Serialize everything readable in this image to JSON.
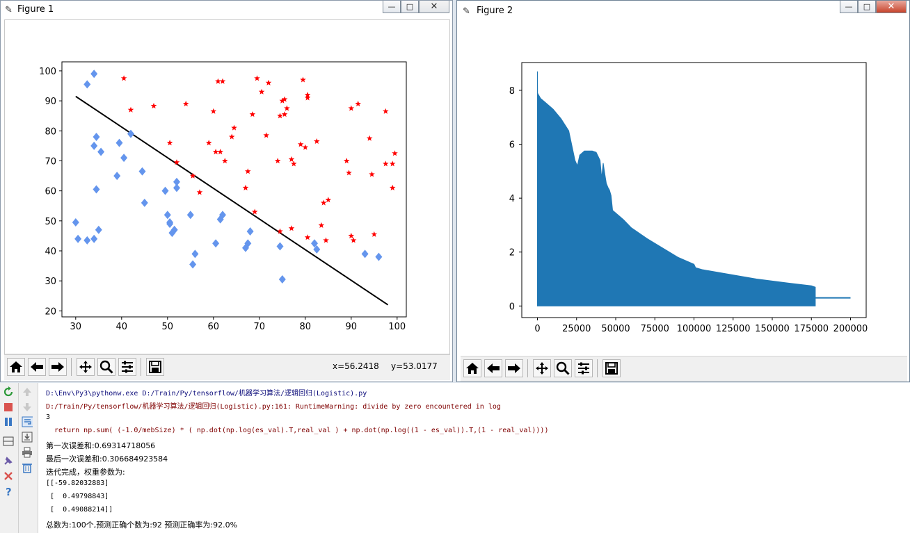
{
  "figure1": {
    "title": "Figure 1",
    "coord_x": "x=56.2418",
    "coord_y": "y=53.0177",
    "buttons": [
      "home",
      "back",
      "forward",
      "pan",
      "zoom",
      "configure",
      "save"
    ]
  },
  "figure2": {
    "title": "Figure 2",
    "buttons": [
      "home",
      "back",
      "forward",
      "pan",
      "zoom",
      "configure",
      "save"
    ]
  },
  "window_buttons": {
    "minimize": "—",
    "maximize": "□",
    "close": "✕"
  },
  "colors": {
    "positive": "#ff0000",
    "negative": "#6495ed",
    "line": "#000000",
    "cost": "#1f77b4",
    "error_text": "#7f0000",
    "path_text": "#0b0b7a"
  },
  "chart_data": [
    {
      "type": "scatter",
      "title": "",
      "xlabel": "",
      "ylabel": "",
      "xlim": [
        27,
        102
      ],
      "ylim": [
        18,
        103
      ],
      "xticks": [
        30,
        40,
        50,
        60,
        70,
        80,
        90,
        100
      ],
      "yticks": [
        20,
        30,
        40,
        50,
        60,
        70,
        80,
        90,
        100
      ],
      "series": [
        {
          "marker": "star",
          "color": "#ff0000",
          "points": [
            [
              40.5,
              97.5
            ],
            [
              42,
              87
            ],
            [
              47,
              88.3
            ],
            [
              50.5,
              76
            ],
            [
              52,
              69.5
            ],
            [
              54,
              89
            ],
            [
              55.5,
              65
            ],
            [
              57,
              59.5
            ],
            [
              60,
              86.5
            ],
            [
              60.5,
              73
            ],
            [
              61,
              96.5
            ],
            [
              61.5,
              73
            ],
            [
              62,
              96.5
            ],
            [
              62.5,
              70
            ],
            [
              59,
              76
            ],
            [
              64,
              78
            ],
            [
              64.5,
              81
            ],
            [
              67,
              61
            ],
            [
              67.5,
              66.5
            ],
            [
              68.5,
              85.5
            ],
            [
              69,
              53
            ],
            [
              69.5,
              97.5
            ],
            [
              70.5,
              93
            ],
            [
              71.5,
              78.5
            ],
            [
              72,
              96
            ],
            [
              74,
              70
            ],
            [
              74.5,
              85
            ],
            [
              75,
              90
            ],
            [
              75.5,
              85.5
            ],
            [
              76,
              87.5
            ],
            [
              75.5,
              90.5
            ],
            [
              77,
              70.5
            ],
            [
              77.5,
              69
            ],
            [
              79,
              75.5
            ],
            [
              79.5,
              97
            ],
            [
              80,
              74.5
            ],
            [
              80.5,
              92
            ],
            [
              80.5,
              91
            ],
            [
              82.5,
              76.5
            ],
            [
              83.5,
              48.5
            ],
            [
              84,
              56
            ],
            [
              85,
              57
            ],
            [
              74.5,
              46.5
            ],
            [
              77,
              47.5
            ],
            [
              80.5,
              44.5
            ],
            [
              84.5,
              43.5
            ],
            [
              89,
              70
            ],
            [
              89.5,
              66
            ],
            [
              90,
              87.5
            ],
            [
              90,
              45
            ],
            [
              90.5,
              43.5
            ],
            [
              91.5,
              89
            ],
            [
              94,
              77.5
            ],
            [
              94.5,
              65.5
            ],
            [
              95,
              45.5
            ],
            [
              97.5,
              69
            ],
            [
              97.5,
              86.5
            ],
            [
              99,
              69
            ],
            [
              99,
              61
            ],
            [
              99.5,
              72.5
            ]
          ]
        },
        {
          "marker": "diamond",
          "color": "#6495ed",
          "points": [
            [
              34,
              99
            ],
            [
              32.5,
              95.5
            ],
            [
              34.5,
              78
            ],
            [
              34,
              75
            ],
            [
              35.5,
              73
            ],
            [
              34.5,
              60.5
            ],
            [
              30,
              49.5
            ],
            [
              30.5,
              44
            ],
            [
              32.5,
              43.5
            ],
            [
              34,
              44
            ],
            [
              35,
              47
            ],
            [
              39,
              65
            ],
            [
              39.5,
              76
            ],
            [
              40.5,
              71
            ],
            [
              42,
              79
            ],
            [
              44.5,
              66.5
            ],
            [
              45,
              56
            ],
            [
              49.5,
              60
            ],
            [
              50,
              52
            ],
            [
              50.5,
              49.5
            ],
            [
              50.5,
              49
            ],
            [
              51,
              46
            ],
            [
              51.5,
              47
            ],
            [
              52,
              63
            ],
            [
              52,
              61
            ],
            [
              55,
              52
            ],
            [
              55.5,
              35.5
            ],
            [
              56,
              39
            ],
            [
              60.5,
              42.5
            ],
            [
              61.5,
              50.5
            ],
            [
              62,
              52
            ],
            [
              67,
              41
            ],
            [
              67.5,
              42.5
            ],
            [
              68,
              46.5
            ],
            [
              74.5,
              41.5
            ],
            [
              75,
              30.5
            ],
            [
              82,
              42.5
            ],
            [
              82.5,
              40.5
            ],
            [
              93,
              39
            ],
            [
              96,
              38
            ]
          ]
        }
      ],
      "decision_line": {
        "x": [
          30,
          98
        ],
        "y": [
          91.5,
          22
        ]
      }
    },
    {
      "type": "line",
      "title": "",
      "xlabel": "",
      "ylabel": "",
      "xlim": [
        -10000,
        210000
      ],
      "ylim": [
        -0.43,
        9.03
      ],
      "xticks": [
        0,
        25000,
        50000,
        75000,
        100000,
        125000,
        150000,
        175000,
        200000
      ],
      "yticks": [
        0,
        2,
        4,
        6,
        8
      ],
      "upper_envelope": {
        "x": [
          0,
          100,
          500,
          1000,
          2000,
          5000,
          10000,
          15000,
          20000,
          24000,
          25500,
          27000,
          30000,
          35000,
          37500,
          40000,
          41000,
          42000,
          43000,
          44000,
          45000,
          46000,
          47000,
          48000,
          50000,
          55000,
          60000,
          70000,
          80000,
          90000,
          100000,
          101000,
          105000,
          120000,
          140000,
          160000,
          175000,
          177500
        ],
        "y": [
          8.7,
          7.9,
          7.85,
          7.8,
          7.7,
          7.55,
          7.3,
          6.95,
          6.5,
          5.4,
          5.2,
          5.6,
          5.75,
          5.75,
          5.7,
          5.4,
          4.75,
          5.3,
          4.9,
          4.55,
          4.4,
          4.3,
          4.1,
          3.55,
          3.45,
          3.2,
          2.9,
          2.5,
          2.15,
          1.8,
          1.55,
          1.42,
          1.35,
          1.2,
          1.0,
          0.85,
          0.75,
          0.7
        ]
      },
      "lower_envelope": {
        "x": [
          0,
          177500
        ],
        "y": [
          0,
          0
        ]
      },
      "tail": {
        "x": [
          177500,
          200000
        ],
        "y": [
          0.3,
          0.3
        ]
      }
    }
  ],
  "console": {
    "lines": [
      {
        "text": "D:\\Env\\Py3\\pythonw.exe D:/Train/Py/tensorflow/机器学习算法/逻辑回归(Logistic).py",
        "kind": "path"
      },
      {
        "text": "D:/Train/Py/tensorflow/机器学习算法/逻辑回归(Logistic).py:161: RuntimeWarning: divide by zero encountered in log",
        "kind": "err"
      },
      {
        "text": "3",
        "kind": "out"
      },
      {
        "text": "  return np.sum( (-1.0/mebSize) * ( np.dot(np.log(es_val).T,real_val ) + np.dot(np.log((1 - es_val)).T,(1 - real_val))))",
        "kind": "err"
      },
      {
        "text": "第一次误差和:0.69314718056",
        "kind": "out"
      },
      {
        "text": "最后一次误差和:0.306684923584",
        "kind": "out"
      },
      {
        "text": "迭代完成，权重参数为:",
        "kind": "out"
      },
      {
        "text": "[[-59.82032883]",
        "kind": "out"
      },
      {
        "text": " [  0.49798843]",
        "kind": "out"
      },
      {
        "text": " [  0.49088214]]",
        "kind": "out"
      },
      {
        "text": "总数为:100个,预测正确个数为:92 预测正确率为:92.0%",
        "kind": "out"
      }
    ],
    "gutter_icons": [
      "rerun-icon",
      "stop-icon",
      "pause-icon",
      "layout-icon",
      "pin-icon",
      "close-icon",
      "help-icon"
    ],
    "gutter2_icons": [
      "up-arrow-icon",
      "down-arrow-icon",
      "soft-wrap-icon",
      "scroll-end-icon",
      "print-icon",
      "trash-icon"
    ]
  }
}
